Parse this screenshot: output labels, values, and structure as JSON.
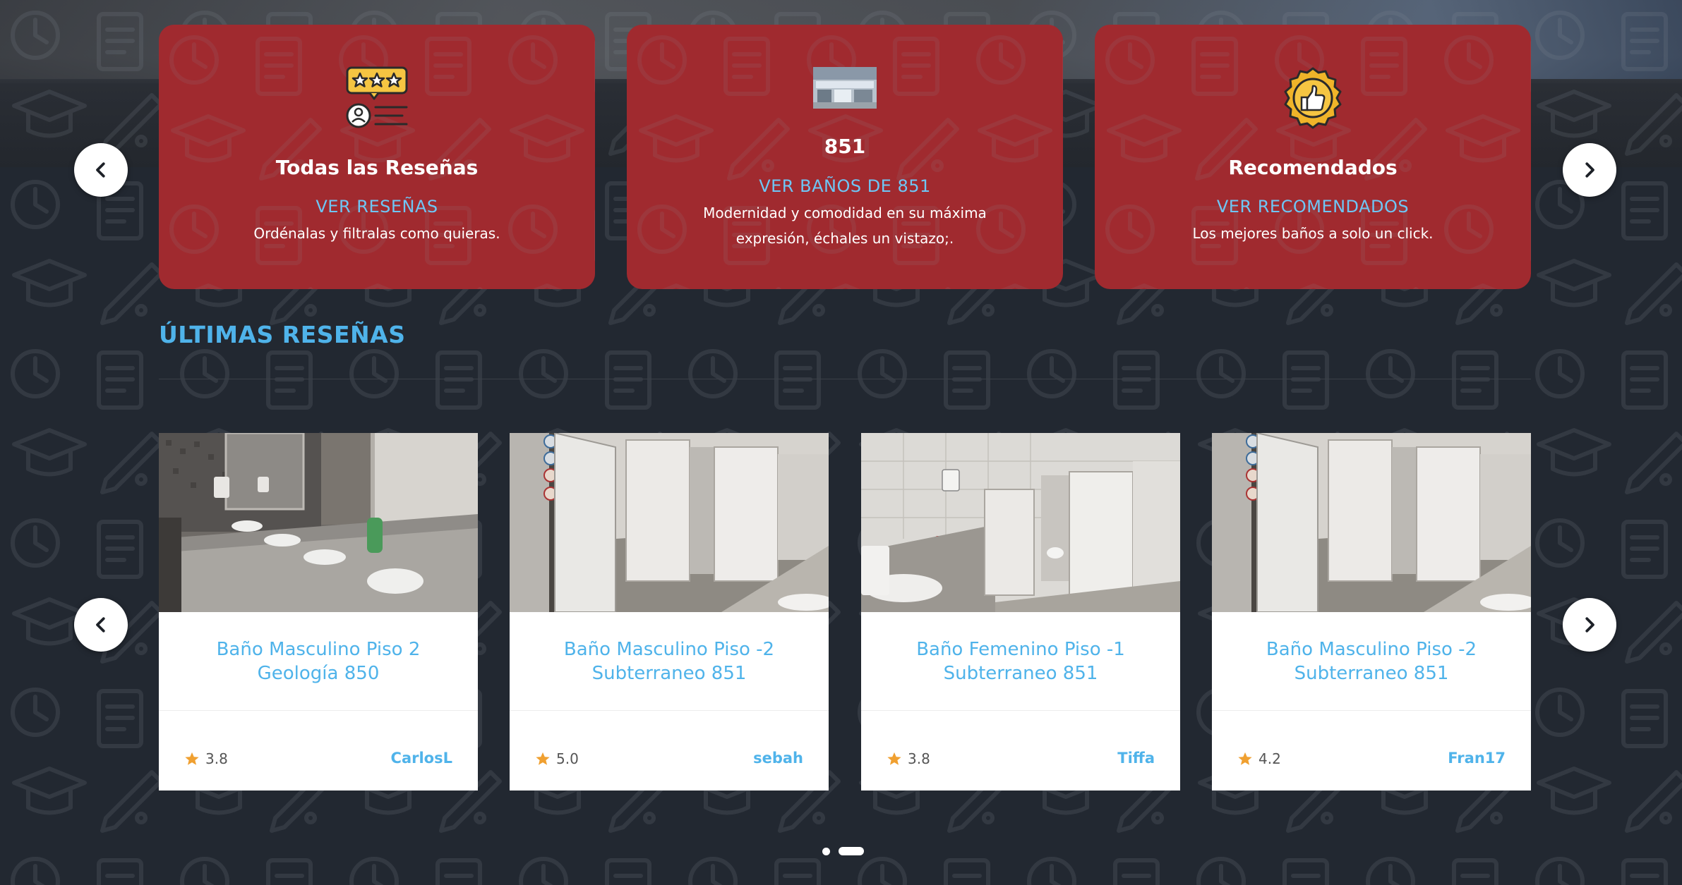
{
  "categories": [
    {
      "title": "Todas las Reseñas",
      "link": "VER RESEÑAS",
      "description": "Ordénalas y filtralas como quieras.",
      "icon": "reviews-icon"
    },
    {
      "title": "851",
      "link": "VER BAÑOS DE 851",
      "description": "Modernidad y comodidad en su máxima expresión, échales un vistazo;.",
      "icon": "building-851-thumbnail"
    },
    {
      "title": "Recomendados",
      "link": "VER RECOMENDADOS",
      "description": "Los mejores baños a solo un click.",
      "icon": "thumbs-up-badge-icon"
    }
  ],
  "section": {
    "title": "ÚLTIMAS RESEÑAS"
  },
  "reviews": [
    {
      "title_line1": "Baño Masculino Piso 2",
      "title_line2": "Geología 850",
      "rating": "3.8",
      "user": "CarlosL"
    },
    {
      "title_line1": "Baño Masculino Piso -2",
      "title_line2": "Subterraneo 851",
      "rating": "5.0",
      "user": "sebah"
    },
    {
      "title_line1": "Baño Femenino Piso -1",
      "title_line2": "Subterraneo 851",
      "rating": "3.8",
      "user": "Tiffa"
    },
    {
      "title_line1": "Baño Masculino Piso -2",
      "title_line2": "Subterraneo 851",
      "rating": "4.2",
      "user": "Fran17"
    }
  ],
  "pagination": {
    "total": 2,
    "active": 2
  },
  "colors": {
    "background": "#222831",
    "card_red": "#a02a2f",
    "accent_blue": "#4fb3ea",
    "link_blue": "#6ec6f5",
    "star": "#f0a030"
  }
}
